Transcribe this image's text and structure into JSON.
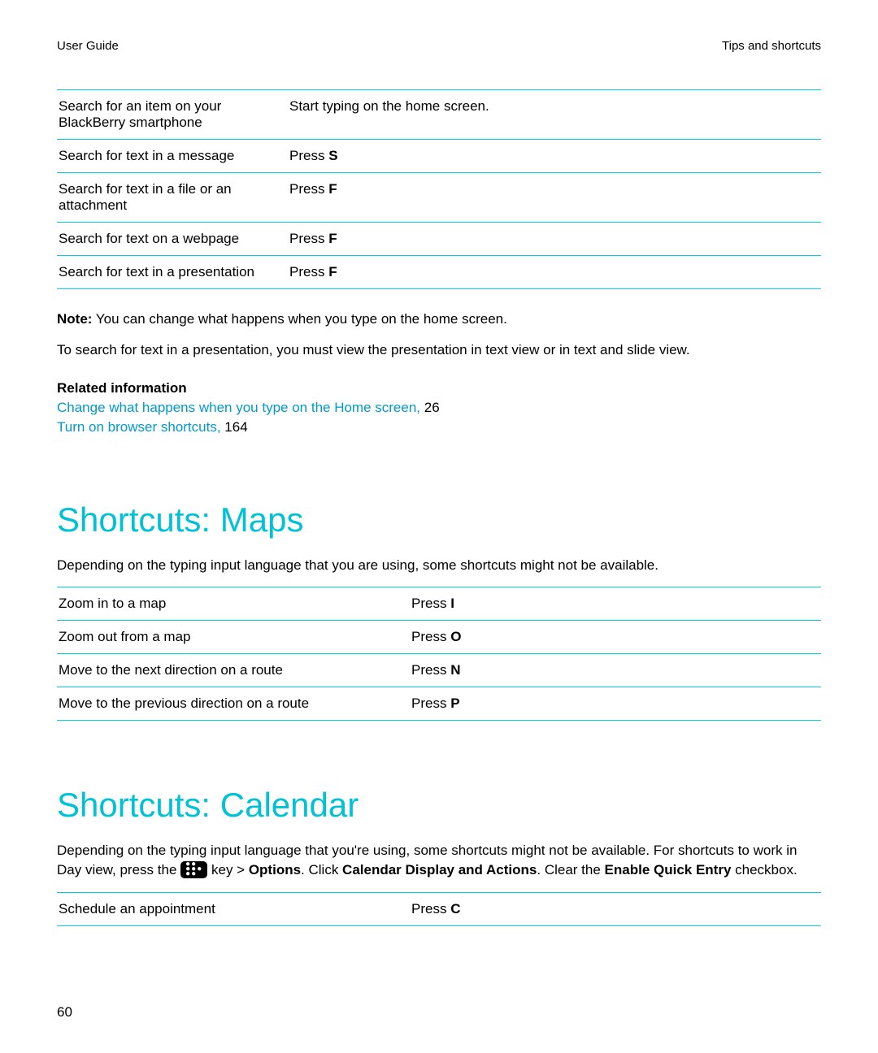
{
  "header": {
    "left": "User Guide",
    "right": "Tips and shortcuts"
  },
  "searchTable": {
    "rows": [
      {
        "action": "Search for an item on your BlackBerry smartphone",
        "key_prefix": "Start typing on the home screen.",
        "key_bold": ""
      },
      {
        "action": "Search for text in a message",
        "key_prefix": "Press ",
        "key_bold": "S"
      },
      {
        "action": "Search for text in a file or an attachment",
        "key_prefix": "Press ",
        "key_bold": "F"
      },
      {
        "action": "Search for text on a webpage",
        "key_prefix": "Press ",
        "key_bold": "F"
      },
      {
        "action": "Search for text in a presentation",
        "key_prefix": "Press ",
        "key_bold": "F"
      }
    ]
  },
  "note": {
    "label": "Note:",
    "text": " You can change what happens when you type on the home screen."
  },
  "searchPara": "To search for text in a presentation, you must view the presentation in text view or in text and slide view.",
  "related": {
    "heading": "Related information",
    "links": [
      {
        "text": "Change what happens when you type on the Home screen,",
        "page": " 26"
      },
      {
        "text": "Turn on browser shortcuts,",
        "page": " 164"
      }
    ]
  },
  "maps": {
    "heading": "Shortcuts: Maps",
    "intro": "Depending on the typing input language that you are using, some shortcuts might not be available.",
    "rows": [
      {
        "action": "Zoom in to a map",
        "key_prefix": "Press ",
        "key_bold": "I"
      },
      {
        "action": "Zoom out from a map",
        "key_prefix": "Press ",
        "key_bold": "O"
      },
      {
        "action": "Move to the next direction on a route",
        "key_prefix": "Press ",
        "key_bold": "N"
      },
      {
        "action": "Move to the previous direction on a route",
        "key_prefix": "Press ",
        "key_bold": "P"
      }
    ]
  },
  "calendar": {
    "heading": "Shortcuts: Calendar",
    "intro_parts": {
      "p1": "Depending on the typing input language that you're using, some shortcuts might not be available. For shortcuts to work in Day view, press the ",
      "p2": " key > ",
      "b1": "Options",
      "p3": ". Click ",
      "b2": "Calendar Display and Actions",
      "p4": ". Clear the ",
      "b3": "Enable Quick Entry",
      "p5": " checkbox."
    },
    "rows": [
      {
        "action": "Schedule an appointment",
        "key_prefix": "Press ",
        "key_bold": "C"
      }
    ]
  },
  "pageNum": "60"
}
